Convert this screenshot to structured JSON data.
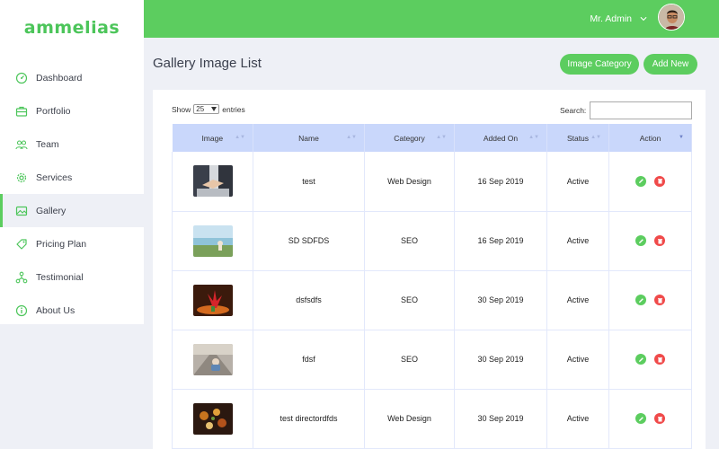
{
  "app": {
    "logo": "ammelias"
  },
  "sidebar": {
    "items": [
      {
        "label": "Dashboard",
        "icon": "dashboard-gauge-icon",
        "active": false
      },
      {
        "label": "Portfolio",
        "icon": "portfolio-briefcase-icon",
        "active": false
      },
      {
        "label": "Team",
        "icon": "team-users-icon",
        "active": false
      },
      {
        "label": "Services",
        "icon": "services-gear-icon",
        "active": false
      },
      {
        "label": "Gallery",
        "icon": "gallery-image-icon",
        "active": true
      },
      {
        "label": "Pricing Plan",
        "icon": "pricing-tag-icon",
        "active": false
      },
      {
        "label": "Testimonial",
        "icon": "testimonial-network-icon",
        "active": false
      },
      {
        "label": "About Us",
        "icon": "info-icon",
        "active": false
      }
    ]
  },
  "header": {
    "user_name": "Mr. Admin"
  },
  "main": {
    "title": "Gallery Image List",
    "image_category_button": "Image Category",
    "add_new_button": "Add New"
  },
  "table_controls": {
    "show_label": "Show",
    "entries_value": "25",
    "entries_label": "entries",
    "search_label": "Search:",
    "search_value": ""
  },
  "table": {
    "columns": [
      "Image",
      "Name",
      "Category",
      "Added On",
      "Status",
      "Action"
    ],
    "rows": [
      {
        "image": "handshake-photo",
        "name": "test",
        "category": "Web Design",
        "added_on": "16 Sep 2019",
        "status": "Active"
      },
      {
        "image": "lake-shore-photo",
        "name": "SD SDFDS",
        "category": "SEO",
        "added_on": "16 Sep 2019",
        "status": "Active"
      },
      {
        "image": "flower-photo",
        "name": "dsfsdfs",
        "category": "SEO",
        "added_on": "30 Sep 2019",
        "status": "Active"
      },
      {
        "image": "child-on-road-photo",
        "name": "fdsf",
        "category": "SEO",
        "added_on": "30 Sep 2019",
        "status": "Active"
      },
      {
        "image": "food-photo",
        "name": "test directordfds",
        "category": "Web Design",
        "added_on": "30 Sep 2019",
        "status": "Active"
      }
    ]
  },
  "colors": {
    "accent": "#5ccd5f",
    "delete": "#f04a4a",
    "table_header": "#c9d7fb",
    "page_bg": "#eef0f6"
  }
}
